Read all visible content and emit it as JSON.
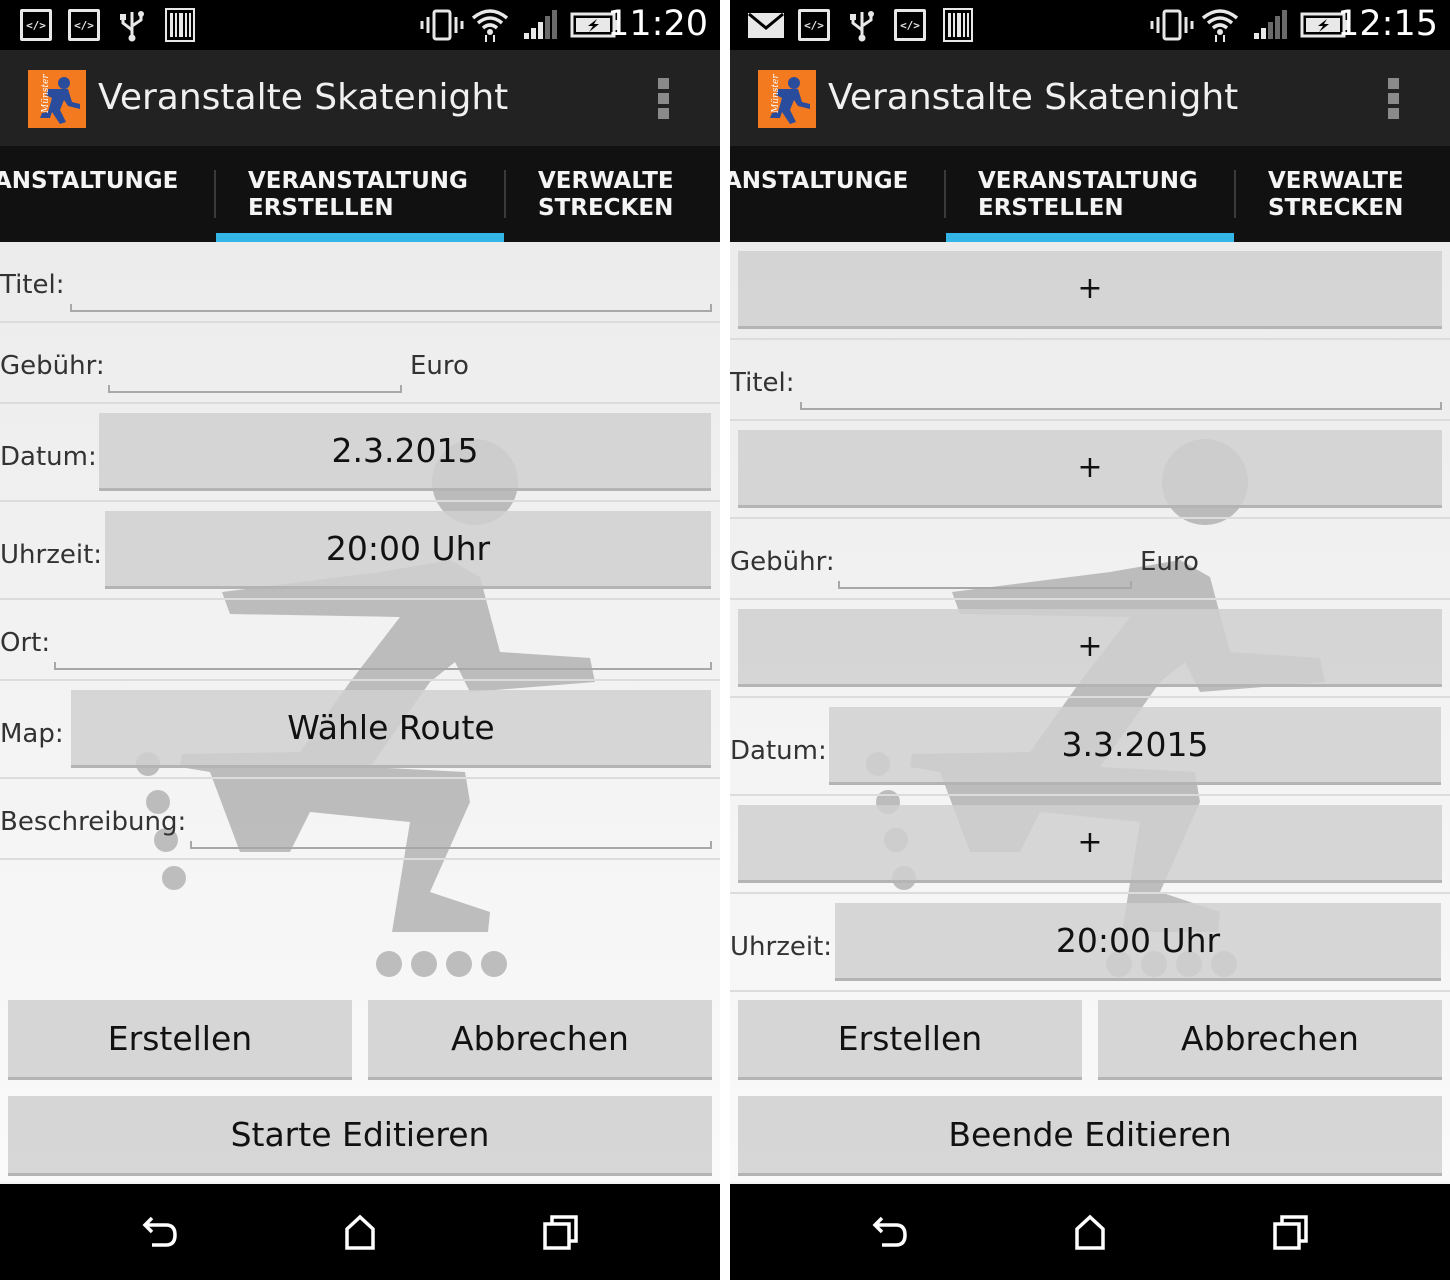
{
  "left": {
    "status": {
      "time": "11:20"
    },
    "app": {
      "title": "Veranstalte Skatenight"
    },
    "tabs": [
      {
        "label": "ANSTALTUNGE"
      },
      {
        "label": "VERANSTALTUNG\nERSTELLEN"
      },
      {
        "label": "VERWALTE\nSTRECKEN"
      }
    ],
    "form": {
      "titel_label": "Titel:",
      "titel_value": "",
      "gebuehr_label": "Gebühr:",
      "gebuehr_value": "",
      "currency": "Euro",
      "datum_label": "Datum:",
      "datum_value": "2.3.2015",
      "uhrzeit_label": "Uhrzeit:",
      "uhrzeit_value": "20:00 Uhr",
      "ort_label": "Ort:",
      "ort_value": "",
      "map_label": "Map:",
      "map_value": "Wähle Route",
      "beschreibung_label": "Beschreibung:",
      "beschreibung_value": ""
    },
    "buttons": {
      "create": "Erstellen",
      "cancel": "Abbrechen",
      "edit": "Starte Editieren"
    }
  },
  "right": {
    "status": {
      "time": "12:15"
    },
    "app": {
      "title": "Veranstalte Skatenight"
    },
    "tabs": [
      {
        "label": "ANSTALTUNGE"
      },
      {
        "label": "VERANSTALTUNG\nERSTELLEN"
      },
      {
        "label": "VERWALTE\nSTRECKEN"
      }
    ],
    "form": {
      "plus": "+",
      "titel_label": "Titel:",
      "titel_value": "",
      "gebuehr_label": "Gebühr:",
      "gebuehr_value": "",
      "currency": "Euro",
      "datum_label": "Datum:",
      "datum_value": "3.3.2015",
      "uhrzeit_label": "Uhrzeit:",
      "uhrzeit_value": "20:00 Uhr"
    },
    "buttons": {
      "create": "Erstellen",
      "cancel": "Abbrechen",
      "edit": "Beende Editieren"
    }
  },
  "colors": {
    "accent": "#33b5e5",
    "action_bar": "#222222",
    "tab_bar": "#111111",
    "logo": "#f47a20"
  },
  "icons": {
    "status_left": [
      "code-icon",
      "code-icon",
      "usb-icon",
      "barcode-icon",
      "vibrate-icon",
      "wifi-icon",
      "signal-icon",
      "battery-charging-icon"
    ],
    "status_right": [
      "mail-icon",
      "code-icon",
      "usb-icon",
      "code-icon",
      "barcode-icon",
      "vibrate-icon",
      "wifi-icon",
      "signal-icon",
      "battery-charging-icon"
    ],
    "nav": [
      "back-icon",
      "home-icon",
      "recents-icon"
    ]
  }
}
